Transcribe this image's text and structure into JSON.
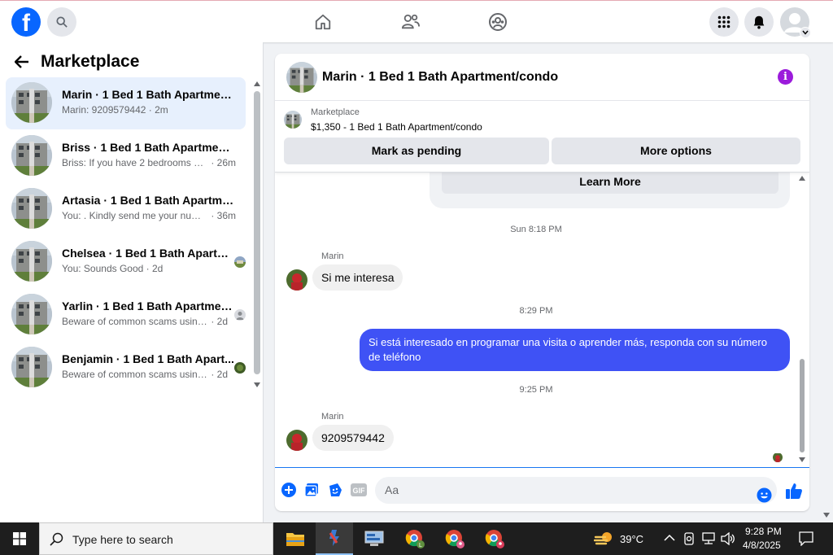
{
  "topbar": {
    "logo_letter": "f",
    "icons": [
      "search-icon",
      "home-icon",
      "friends-icon",
      "groups-icon",
      "menu-grid-icon",
      "bell-icon",
      "profile-avatar"
    ]
  },
  "sidebar": {
    "title": "Marketplace",
    "conversations": [
      {
        "title": "Marin · 1 Bed 1 Bath Apartment/...",
        "preview": "Marin: 9209579442",
        "time": "2m",
        "active": true
      },
      {
        "title": "Briss · 1 Bed 1 Bath Apartment/c...",
        "preview": "Briss: If you have 2 bedrooms yes...",
        "time": "26m"
      },
      {
        "title": "Artasia · 1 Bed 1 Bath Apartment...",
        "preview": "You: . Kindly send me your numb...",
        "time": "36m"
      },
      {
        "title": "Chelsea · 1 Bed 1 Bath Apartm...",
        "preview": "You: Sounds Good",
        "time": "2d"
      },
      {
        "title": "Yarlin · 1 Bed 1 Bath Apartmen...",
        "preview": "Beware of common scams using...",
        "time": "2d"
      },
      {
        "title": "Benjamin · 1 Bed 1 Bath Apart...",
        "preview": "Beware of common scams using...",
        "time": "2d"
      }
    ]
  },
  "chat": {
    "title": "Marin · 1 Bed 1 Bath Apartment/condo",
    "listing_source": "Marketplace",
    "listing_line": "$1,350 - 1 Bed 1 Bath Apartment/condo",
    "mark_pending_label": "Mark as pending",
    "more_options_label": "More options",
    "learn_more_label": "Learn More",
    "messages": [
      {
        "type": "timestamp",
        "text": "Sun 8:18 PM"
      },
      {
        "type": "sender",
        "text": "Marin"
      },
      {
        "type": "in",
        "text": "Si me interesa"
      },
      {
        "type": "timestamp",
        "text": "8:29 PM"
      },
      {
        "type": "out",
        "text": "Si está interesado en programar una visita o aprender más, responda con su número de teléfono"
      },
      {
        "type": "timestamp",
        "text": "9:25 PM"
      },
      {
        "type": "sender",
        "text": "Marin"
      },
      {
        "type": "in",
        "text": "9209579442"
      }
    ],
    "composer_placeholder": "Aa"
  },
  "taskbar": {
    "search_placeholder": "Type here to search",
    "weather": "39°C",
    "time": "9:28 PM",
    "date": "4/8/2025"
  },
  "colors": {
    "brand": "#0866ff",
    "outgoing_bubble": "#3f52f5",
    "info_icon": "#9b1bdb"
  }
}
